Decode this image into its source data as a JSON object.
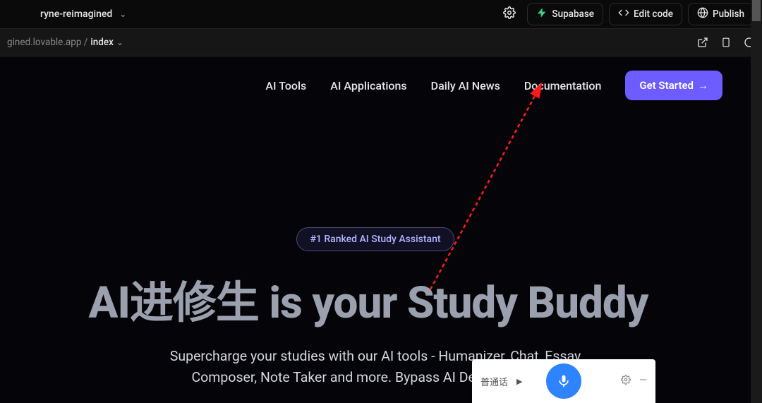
{
  "topbar": {
    "project_name": "ryne-reimagined",
    "supabase_label": "Supabase",
    "edit_code_label": "Edit code",
    "publish_label": "Publish"
  },
  "urlbar": {
    "host": "gined.lovable.app / ",
    "path": "index"
  },
  "site": {
    "nav": {
      "ai_tools": "AI Tools",
      "ai_apps": "AI Applications",
      "daily_news": "Daily AI News",
      "docs": "Documentation",
      "cta": "Get Started"
    },
    "badge": "#1 Ranked AI Study Assistant",
    "hero_title": "AI进修生 is your Study Buddy",
    "hero_sub_line1": "Supercharge your studies with our AI tools - Humanizer, Chat, Essay",
    "hero_sub_line2": "Composer, Note Taker and more. Bypass AI Detection easily."
  },
  "ime": {
    "language": "普通话"
  }
}
